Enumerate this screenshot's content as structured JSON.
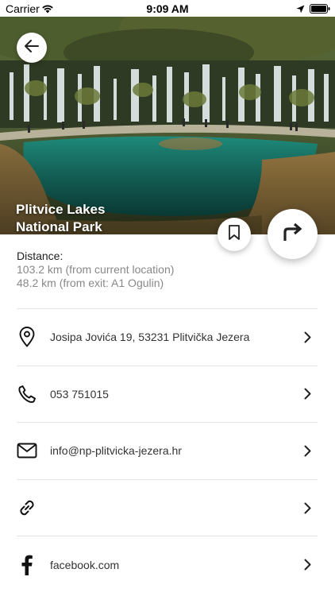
{
  "status_bar": {
    "carrier": "Carrier",
    "time": "9:09 AM"
  },
  "place": {
    "name_line1": "Plitvice Lakes",
    "name_line2": "National Park"
  },
  "distance": {
    "label": "Distance:",
    "from_current": "103.2 km (from current location)",
    "from_exit": "48.2 km (from exit: A1 Ogulin)"
  },
  "info_rows": [
    {
      "icon": "map-pin-icon",
      "text": "Josipa Jovića 19, 53231 Plitvička Jezera"
    },
    {
      "icon": "phone-icon",
      "text": "053 751015"
    },
    {
      "icon": "mail-icon",
      "text": "info@np-plitvicka-jezera.hr"
    },
    {
      "icon": "link-icon",
      "text": ""
    },
    {
      "icon": "facebook-icon",
      "text": "facebook.com"
    }
  ],
  "colors": {
    "accent": "#ffffff",
    "text": "#1a1a1a",
    "muted": "#888888",
    "divider": "#e3e3e3"
  }
}
